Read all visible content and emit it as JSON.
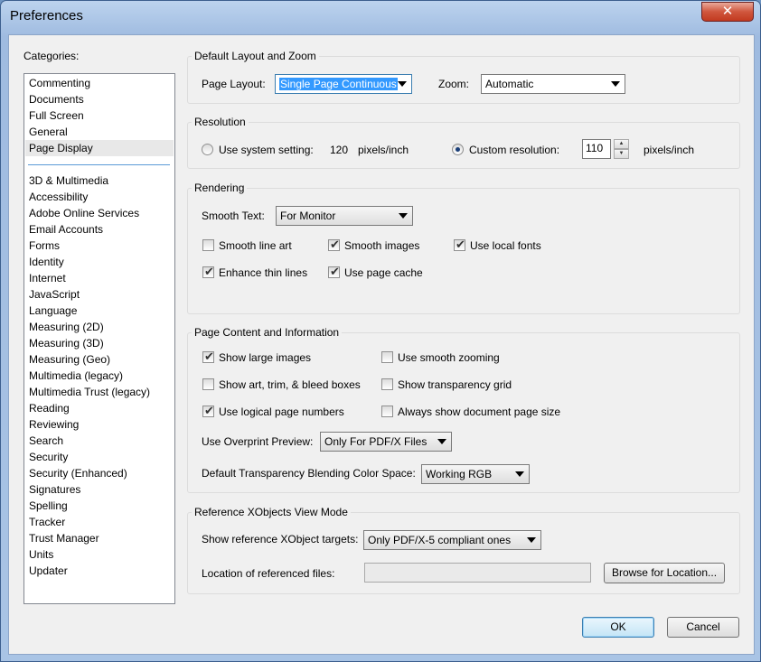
{
  "window": {
    "title": "Preferences",
    "close_glyph": "✕"
  },
  "categories": {
    "label": "Categories:",
    "group1": [
      "Commenting",
      "Documents",
      "Full Screen",
      "General",
      "Page Display"
    ],
    "selected": "Page Display",
    "group2": [
      "3D & Multimedia",
      "Accessibility",
      "Adobe Online Services",
      "Email Accounts",
      "Forms",
      "Identity",
      "Internet",
      "JavaScript",
      "Language",
      "Measuring (2D)",
      "Measuring (3D)",
      "Measuring (Geo)",
      "Multimedia (legacy)",
      "Multimedia Trust (legacy)",
      "Reading",
      "Reviewing",
      "Search",
      "Security",
      "Security (Enhanced)",
      "Signatures",
      "Spelling",
      "Tracker",
      "Trust Manager",
      "Units",
      "Updater"
    ]
  },
  "layout_zoom": {
    "title": "Default Layout and Zoom",
    "page_layout_label": "Page Layout:",
    "page_layout_value": "Single Page Continuous",
    "zoom_label": "Zoom:",
    "zoom_value": "Automatic"
  },
  "resolution": {
    "title": "Resolution",
    "system_label": "Use system setting:",
    "system_value": "120",
    "system_unit": "pixels/inch",
    "custom_label": "Custom resolution:",
    "custom_value": "110",
    "custom_unit": "pixels/inch",
    "selected": "custom"
  },
  "rendering": {
    "title": "Rendering",
    "smooth_text_label": "Smooth Text:",
    "smooth_text_value": "For Monitor",
    "smooth_line_art": {
      "label": "Smooth line art",
      "checked": false
    },
    "smooth_images": {
      "label": "Smooth images",
      "checked": true
    },
    "local_fonts": {
      "label": "Use local fonts",
      "checked": true
    },
    "enhance_thin": {
      "label": "Enhance thin lines",
      "checked": true
    },
    "page_cache": {
      "label": "Use page cache",
      "checked": true
    }
  },
  "page_content": {
    "title": "Page Content and Information",
    "large_images": {
      "label": "Show large images",
      "checked": true
    },
    "smooth_zooming": {
      "label": "Use smooth zooming",
      "checked": false
    },
    "art_trim": {
      "label": "Show art, trim, & bleed boxes",
      "checked": false
    },
    "transparency_grid": {
      "label": "Show transparency grid",
      "checked": false
    },
    "logical_numbers": {
      "label": "Use logical page numbers",
      "checked": true
    },
    "doc_page_size": {
      "label": "Always show document page size",
      "checked": false
    },
    "overprint_label": "Use Overprint Preview:",
    "overprint_value": "Only For PDF/X Files",
    "blending_label": "Default Transparency Blending Color Space:",
    "blending_value": "Working RGB"
  },
  "xobjects": {
    "title": "Reference XObjects View Mode",
    "targets_label": "Show reference XObject targets:",
    "targets_value": "Only PDF/X-5 compliant ones",
    "location_label": "Location of referenced files:",
    "location_value": "",
    "browse_label": "Browse for Location..."
  },
  "footer": {
    "ok_label": "OK",
    "cancel_label": "Cancel"
  },
  "glyphs": {
    "check": "✔",
    "up": "▲",
    "down": "▼"
  }
}
